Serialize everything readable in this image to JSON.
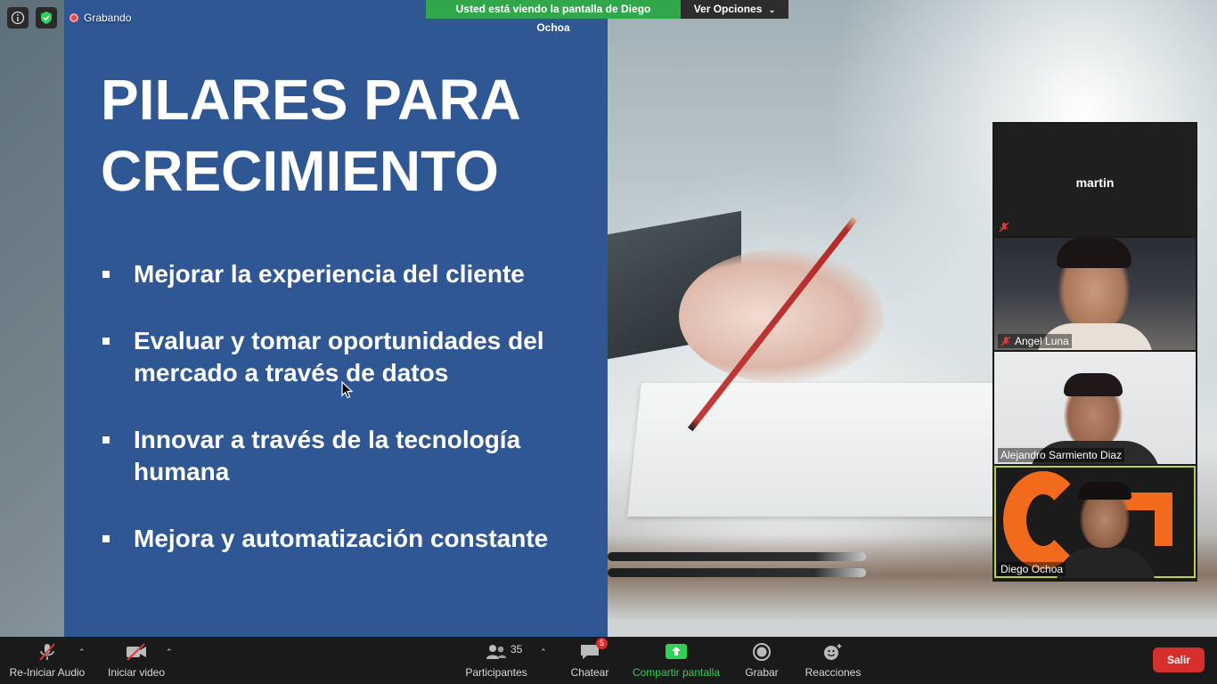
{
  "top": {
    "info_icon": "info-icon",
    "security_icon": "shield-icon",
    "recording_label": "Grabando",
    "banner_text": "Usted está viendo la pantalla de Diego Ochoa",
    "view_options_label": "Ver Opciones"
  },
  "slide": {
    "title": "PILARES PARA\nCRECIMIENTO",
    "bullets": [
      "Mejorar la experiencia del cliente",
      "Evaluar y tomar oportunidades del mercado a través de datos",
      "Innovar a través de la tecnología humana",
      "Mejora y automatización constante"
    ]
  },
  "gallery": {
    "tiles": [
      {
        "name": "martin",
        "muted": true,
        "video": false
      },
      {
        "name": "Angel Luna",
        "muted": true,
        "video": true
      },
      {
        "name": "Alejandro Sarmiento Diaz",
        "muted": false,
        "video": true
      },
      {
        "name": "Diego Ochoa",
        "muted": false,
        "video": true,
        "active": true
      }
    ]
  },
  "toolbar": {
    "audio_label": "Re-Iniciar Audio",
    "video_label": "Iniciar video",
    "participants_label": "Participantes",
    "participants_count": "35",
    "chat_label": "Chatear",
    "chat_badge": "5",
    "share_label": "Compartir pantalla",
    "record_label": "Grabar",
    "reactions_label": "Reacciones",
    "leave_label": "Salir"
  },
  "colors": {
    "slide_blue": "#2f5794",
    "banner_green": "#2fa74a",
    "leave_red": "#d62d2d",
    "share_green": "#2fd157",
    "active_speaker": "#b7d24a"
  }
}
